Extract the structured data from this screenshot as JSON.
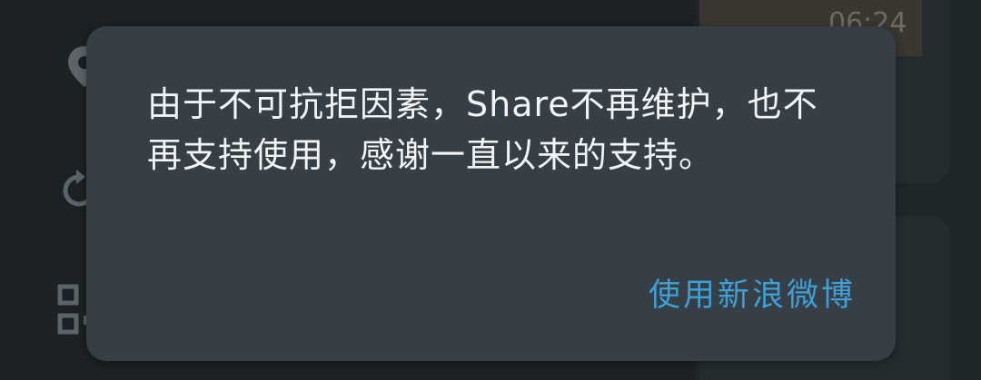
{
  "background": {
    "time": "06:24",
    "icons": [
      "location-pin-icon",
      "refresh-icon",
      "qr-code-icon"
    ]
  },
  "dialog": {
    "message": "由于不可抗拒因素，Share不再维护，也不再支持使用，感谢一直以来的支持。",
    "action_label": "使用新浪微博"
  },
  "colors": {
    "dialog_bg": "#353f45",
    "text": "#f2f4f5",
    "accent": "#3f9fd6"
  }
}
